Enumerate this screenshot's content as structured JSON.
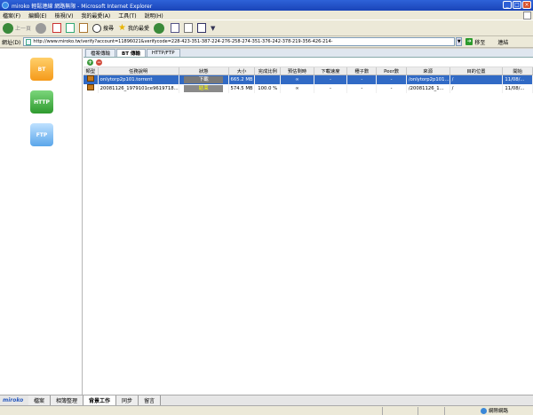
{
  "window": {
    "title": "miroko 輕鬆連線 網路無限 - Microsoft Internet Explorer"
  },
  "menu": [
    "檔案(F)",
    "編輯(E)",
    "檢視(V)",
    "我的最愛(A)",
    "工具(T)",
    "說明(H)"
  ],
  "toolbar": {
    "back": "上一頁",
    "search": "搜尋",
    "favorites": "我的最愛"
  },
  "address": {
    "label": "網址(D)",
    "url": "http://www.miroko.tw/verify?account=11896021&verifycode=228-423-351-387-224-276-258-274-351-376-242-378-219-356-426-214-",
    "go": "移至",
    "links": "連結"
  },
  "tabs": [
    "檔案傳輸",
    "BT 傳輸",
    "HTTP/FTP"
  ],
  "columns": [
    "類型",
    "任務說明",
    "狀態",
    "大小",
    "完成比例",
    "預估剩時",
    "下載速度",
    "種子數",
    "Peer數",
    "來源",
    "目的位置",
    "開始"
  ],
  "rows": [
    {
      "desc": "onlytorp2p101.torrent",
      "status": "下載",
      "size": "665.2 MB",
      "progress": "",
      "eta": "∞",
      "speed": "-",
      "seeds": "-",
      "peers": "-",
      "source": "/onlytorp2p101...",
      "dest": "/",
      "start": "11/08/..."
    },
    {
      "desc": "20081126_1979101ce9619718...",
      "status": "結束",
      "size": "574.5 MB",
      "progress": "100.0 %",
      "eta": "∞",
      "speed": "-",
      "seeds": "-",
      "peers": "-",
      "source": "/20081126_1...",
      "dest": "/",
      "start": "11/08/..."
    }
  ],
  "left_icons": [
    "BT",
    "HTTP",
    "FTP"
  ],
  "bottom_tabs": [
    "miroko",
    "檔案",
    "相簿整理",
    "背景工作",
    "同步",
    "留言"
  ],
  "status_zone": "網際網路"
}
